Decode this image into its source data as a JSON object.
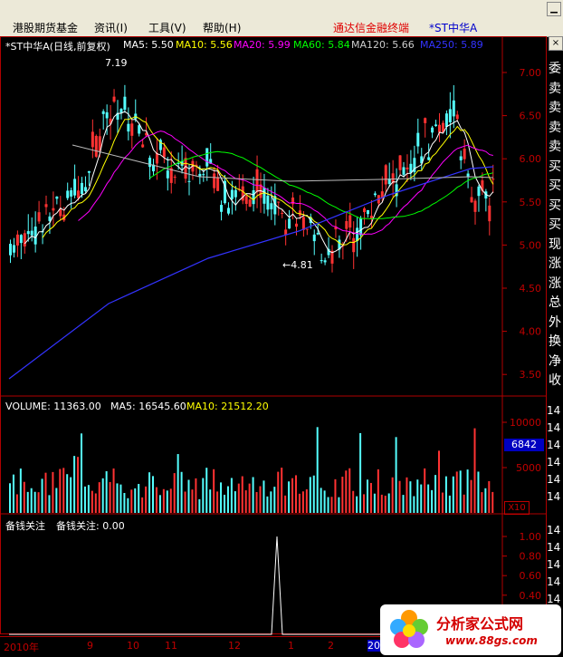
{
  "menu": {
    "items": [
      "港股期货基金",
      "资讯(I)",
      "工具(V)",
      "帮助(H)"
    ],
    "app_title": "通达信金融终端",
    "stock_title": "*ST中华A"
  },
  "main_panel": {
    "title": "*ST中华A(日线,前复权)",
    "ma": [
      {
        "label": "MA5: 5.50",
        "color": "#ffffff"
      },
      {
        "label": "MA10: 5.56",
        "color": "#ffff00"
      },
      {
        "label": "MA20: 5.99",
        "color": "#ff00ff"
      },
      {
        "label": "MA60: 5.84",
        "color": "#00ff00"
      },
      {
        "label": "MA120: 5.66",
        "color": "#cccccc"
      },
      {
        "label": "MA250: 5.89",
        "color": "#3333ff"
      }
    ],
    "high_label": "7.19",
    "low_label": "4.81",
    "yticks": [
      "7.00",
      "6.50",
      "6.00",
      "5.50",
      "5.00",
      "4.50",
      "4.00",
      "3.50"
    ]
  },
  "volume_panel": {
    "title": "VOLUME: 11363.00",
    "ma5": "MA5: 16545.60",
    "ma10": "MA10: 21512.20",
    "yticks": [
      "10000",
      "5000"
    ],
    "current": "6842",
    "unit": "X10"
  },
  "indicator_panel": {
    "title": "备钱关注",
    "value_label": "备钱关注: 0.00",
    "yticks": [
      "1.00",
      "0.80",
      "0.60",
      "0.40",
      "0.20"
    ]
  },
  "right_labels": [
    "委",
    "卖",
    "卖",
    "卖",
    "卖",
    "买",
    "买",
    "买",
    "买",
    "现",
    "涨",
    "涨",
    "总",
    "外",
    "换",
    "净",
    "收"
  ],
  "right_vol_labels": [
    "14",
    "14",
    "14",
    "14",
    "14",
    "14"
  ],
  "right_ind_labels": [
    "14",
    "14",
    "14",
    "14",
    "14",
    "14"
  ],
  "date_axis": [
    "2010年",
    "9",
    "10",
    "11",
    "12",
    "1",
    "2",
    "20",
    "11",
    "三"
  ],
  "watermark": {
    "line1": "分析家公式网",
    "line2": "www.88gs.com"
  },
  "colors": {
    "up": "#ff3232",
    "down": "#54ffff",
    "frame": "#b00000"
  }
}
